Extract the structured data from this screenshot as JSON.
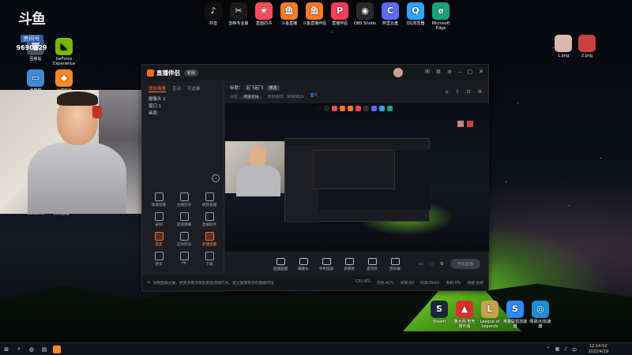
{
  "desktop": {
    "top_icons": [
      {
        "label": "抖音",
        "icon": "tiktok-icon",
        "color": "#111111",
        "glyph": "♪"
      },
      {
        "label": "剪映专业版",
        "icon": "capcut-icon",
        "color": "#1a1a1a",
        "glyph": "✂"
      },
      {
        "label": "直面同书",
        "icon": "note-icon",
        "color": "#ff4b5c",
        "glyph": "❀"
      },
      {
        "label": "斗鱼直播",
        "icon": "douyu-live-icon",
        "color": "#ff7a20",
        "glyph": "鱼"
      },
      {
        "label": "斗鱼直播伴侣",
        "icon": "douyu-companion-icon",
        "color": "#ff7a20",
        "glyph": "鱼"
      },
      {
        "label": "直播伴侣",
        "icon": "live-companion-icon",
        "color": "#ff3b5c",
        "glyph": "P"
      },
      {
        "label": "OBS Studio",
        "icon": "obs-icon",
        "color": "#2a2a2a",
        "glyph": "◉"
      },
      {
        "label": "阿里云盘",
        "icon": "cloud-drive-icon",
        "color": "#5a6cff",
        "glyph": "C"
      },
      {
        "label": "QQ浏览器",
        "icon": "qq-browser-icon",
        "color": "#2da6ff",
        "glyph": "Q"
      },
      {
        "label": "Microsoft Edge",
        "icon": "edge-icon",
        "color": "#1aa37a",
        "glyph": "e"
      }
    ],
    "left_icons": [
      {
        "label": "回收站",
        "icon": "recycle-bin-icon"
      },
      {
        "label": "GeForce Experience",
        "icon": "geforce-icon"
      },
      {
        "label": "此电脑",
        "icon": "computer-icon"
      },
      {
        "label": "火绒安全",
        "icon": "security-icon"
      },
      {
        "label": "WeGame",
        "icon": "wegame-icon"
      },
      {
        "label": "腾讯会议",
        "icon": "meeting-icon"
      }
    ],
    "right_files": [
      {
        "label": "1.png",
        "icon": "image-file-icon"
      },
      {
        "label": "2.png",
        "icon": "image-file-icon"
      }
    ],
    "dock_icons": [
      {
        "label": "Steam",
        "icon": "steam-icon",
        "color": "#1b2838",
        "glyph": "S"
      },
      {
        "label": "鲁大师 电竞 娱乐版",
        "icon": "game-center-icon",
        "color": "#d9302b",
        "glyph": "▲"
      },
      {
        "label": "League of Legends",
        "icon": "lol-icon",
        "color": "#c8a24a",
        "glyph": "L"
      },
      {
        "label": "英雄联盟加速器",
        "icon": "accelerator-icon",
        "color": "#2d8bff",
        "glyph": "S"
      },
      {
        "label": "网易UU加速器",
        "icon": "uu-icon",
        "color": "#1b8fd8",
        "glyph": "◎"
      }
    ]
  },
  "overlay": {
    "logo": "斗鱼",
    "room_label": "房间号",
    "room_number": "9690829"
  },
  "app": {
    "title": "直播伴侣",
    "version": "新版",
    "sidebar_tabs": [
      "添加场景",
      "互动",
      "可选素"
    ],
    "sidebar_list": [
      "摄像头 1",
      "窗口 1",
      "画面"
    ],
    "tools": [
      {
        "label": "新增场景",
        "icon": "scene-icon",
        "accent": false
      },
      {
        "label": "主播任务",
        "icon": "task-icon",
        "accent": false
      },
      {
        "label": "视频直播",
        "icon": "video-icon",
        "accent": false
      },
      {
        "label": "录制",
        "icon": "record-icon",
        "accent": false
      },
      {
        "label": "高清弹幕",
        "icon": "danmu-icon",
        "accent": false
      },
      {
        "label": "直播助手",
        "icon": "helper-icon",
        "accent": false
      },
      {
        "label": "连麦",
        "icon": "connect-icon",
        "accent": true
      },
      {
        "label": "互动玩法",
        "icon": "play-icon",
        "accent": false
      },
      {
        "label": "开播提醒",
        "icon": "remind-icon",
        "accent": true
      },
      {
        "label": "更多",
        "icon": "more-icon",
        "accent": false
      },
      {
        "label": "PK",
        "icon": "pk-icon",
        "accent": false
      },
      {
        "label": "下载",
        "icon": "download-icon",
        "accent": false
      }
    ],
    "info": {
      "title_label": "标题：",
      "title_value": "起飞起飞",
      "edit_tag": "修改",
      "category_label": "分区：",
      "category_value": "网游竞技",
      "room_id_label": "房间号ID：",
      "room_id_value": "9690829",
      "viewers": "0"
    },
    "bottom_buttons": [
      {
        "label": "直播画面",
        "icon": "screen-icon"
      },
      {
        "label": "摄像头",
        "icon": "camera-icon"
      },
      {
        "label": "手机投屏",
        "icon": "phone-icon"
      },
      {
        "label": "多媒体",
        "icon": "media-icon"
      },
      {
        "label": "麦克风",
        "icon": "mic-icon"
      },
      {
        "label": "扬声器",
        "icon": "speaker-icon"
      }
    ],
    "start_button": "开始直播",
    "status_message": "文明直播主播，拒绝涉黄涉政及其他违规行为，建立健康有序的直播环境",
    "metrics": [
      "CPU:8%",
      "内存:42%",
      "帧率:60",
      "码率:0kb/s",
      "丢帧:0%",
      "网络:良好"
    ]
  },
  "taskbar": {
    "time": "12:14:52",
    "date": "2022/4/19"
  }
}
